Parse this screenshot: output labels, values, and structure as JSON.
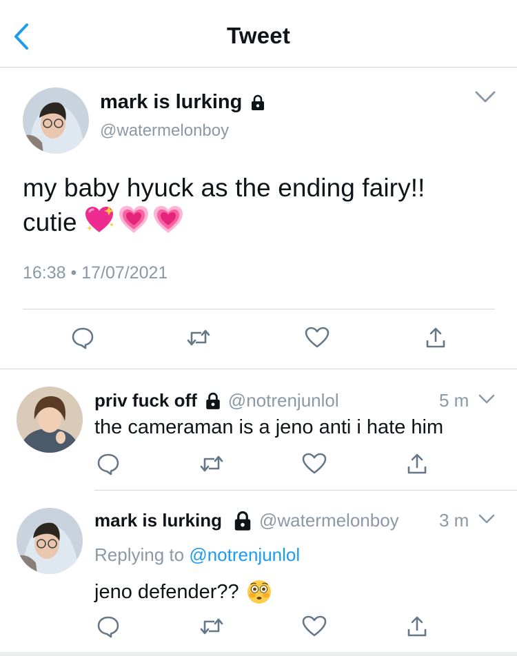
{
  "header": {
    "title": "Tweet",
    "back_icon": "chevron-left-icon"
  },
  "colors": {
    "accent": "#1d9bf0",
    "secondary_text": "#8b98a5",
    "divider": "#cfd9de"
  },
  "main_tweet": {
    "display_name": "mark is lurking",
    "handle": "@watermelonboy",
    "protected_icon": "lock-icon",
    "text_line1": "my baby hyuck as the ending fairy!!",
    "text_line2": "cutie",
    "emojis": [
      "sparkling-heart-emoji",
      "growing-heart-emoji",
      "growing-heart-emoji"
    ],
    "timestamp": "16:38 • 17/07/2021",
    "actions": [
      "reply-icon",
      "retweet-icon",
      "like-icon",
      "share-icon"
    ]
  },
  "replies": [
    {
      "display_name": "priv fuck off",
      "handle": "@notrenjunlol",
      "time": "5 m",
      "text": "the cameraman is a jeno anti i hate him"
    },
    {
      "display_name": "mark is lurking",
      "handle": "@watermelonboy",
      "time": "3 m",
      "replying_prefix": "Replying to",
      "replying_to": "@notrenjunlol",
      "text": "jeno defender??",
      "emoji": "flushed-face-emoji"
    }
  ]
}
